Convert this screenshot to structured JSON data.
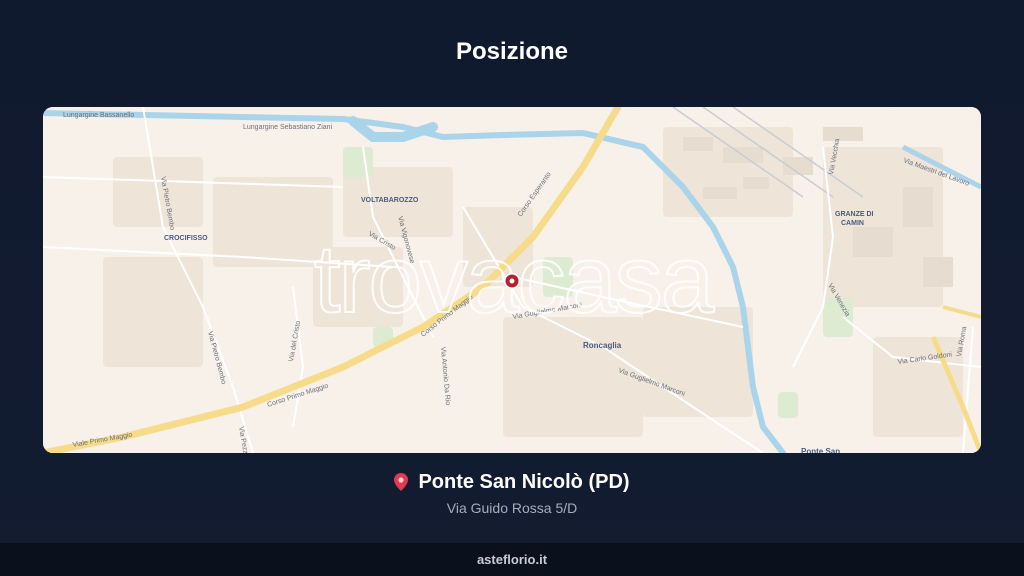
{
  "title": "Posizione",
  "map": {
    "watermark": "trovacasa",
    "place_labels": [
      "VOLTABAROZZO",
      "CROCIFISSO",
      "Roncaglia",
      "GRANZE DI",
      "CAMIN",
      "Ponte San"
    ],
    "street_labels": [
      "Lungargine Bassanello",
      "Lungargine Sebastiano Ziani",
      "Corso Esperanto",
      "Via Pietro Bembo",
      "Via Guglielmo Marconi",
      "Corso Primo Maggio",
      "Via Vigonovese",
      "Via Cristo",
      "Via del Cristo",
      "Via Antonio Da Rio",
      "Via Carlo Goldoni",
      "Via Vecchia",
      "Via Maestri del Lavoro",
      "Via Venezia",
      "Viale Primo Maggio",
      "Via Pezzoli",
      "Via Roma"
    ],
    "marker_icon": "location-marker-icon"
  },
  "location": {
    "icon": "pin-icon",
    "name": "Ponte San Nicolò (PD)",
    "address": "Via Guido Rossa 5/D"
  },
  "footer": {
    "site": "asteflorio.it"
  }
}
